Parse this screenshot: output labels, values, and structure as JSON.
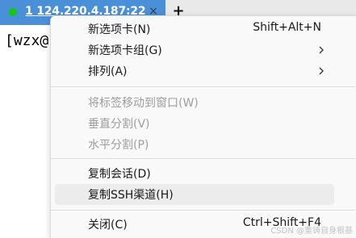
{
  "tab": {
    "title": "1 124.220.4.187:22",
    "close_glyph": "×",
    "add_glyph": "+",
    "status_color": "#16c60c"
  },
  "terminal": {
    "text": "[wzx@"
  },
  "menu": {
    "items": [
      {
        "label": "新选项卡(N)",
        "shortcut": "Shift+Alt+N"
      },
      {
        "label": "新选项卡组(G)",
        "submenu": true
      },
      {
        "label": "排列(A)",
        "submenu": true
      },
      {
        "label": "将标签移动到窗口(W)",
        "disabled": true
      },
      {
        "label": "垂直分割(V)",
        "disabled": true
      },
      {
        "label": "水平分割(P)",
        "disabled": true
      },
      {
        "label": "复制会话(D)"
      },
      {
        "label": "复制SSH渠道(H)",
        "highlighted": true
      },
      {
        "label": "关闭(C)",
        "shortcut": "Ctrl+Shift+F4"
      }
    ]
  },
  "watermark": "CSDN @重铸自身根基"
}
